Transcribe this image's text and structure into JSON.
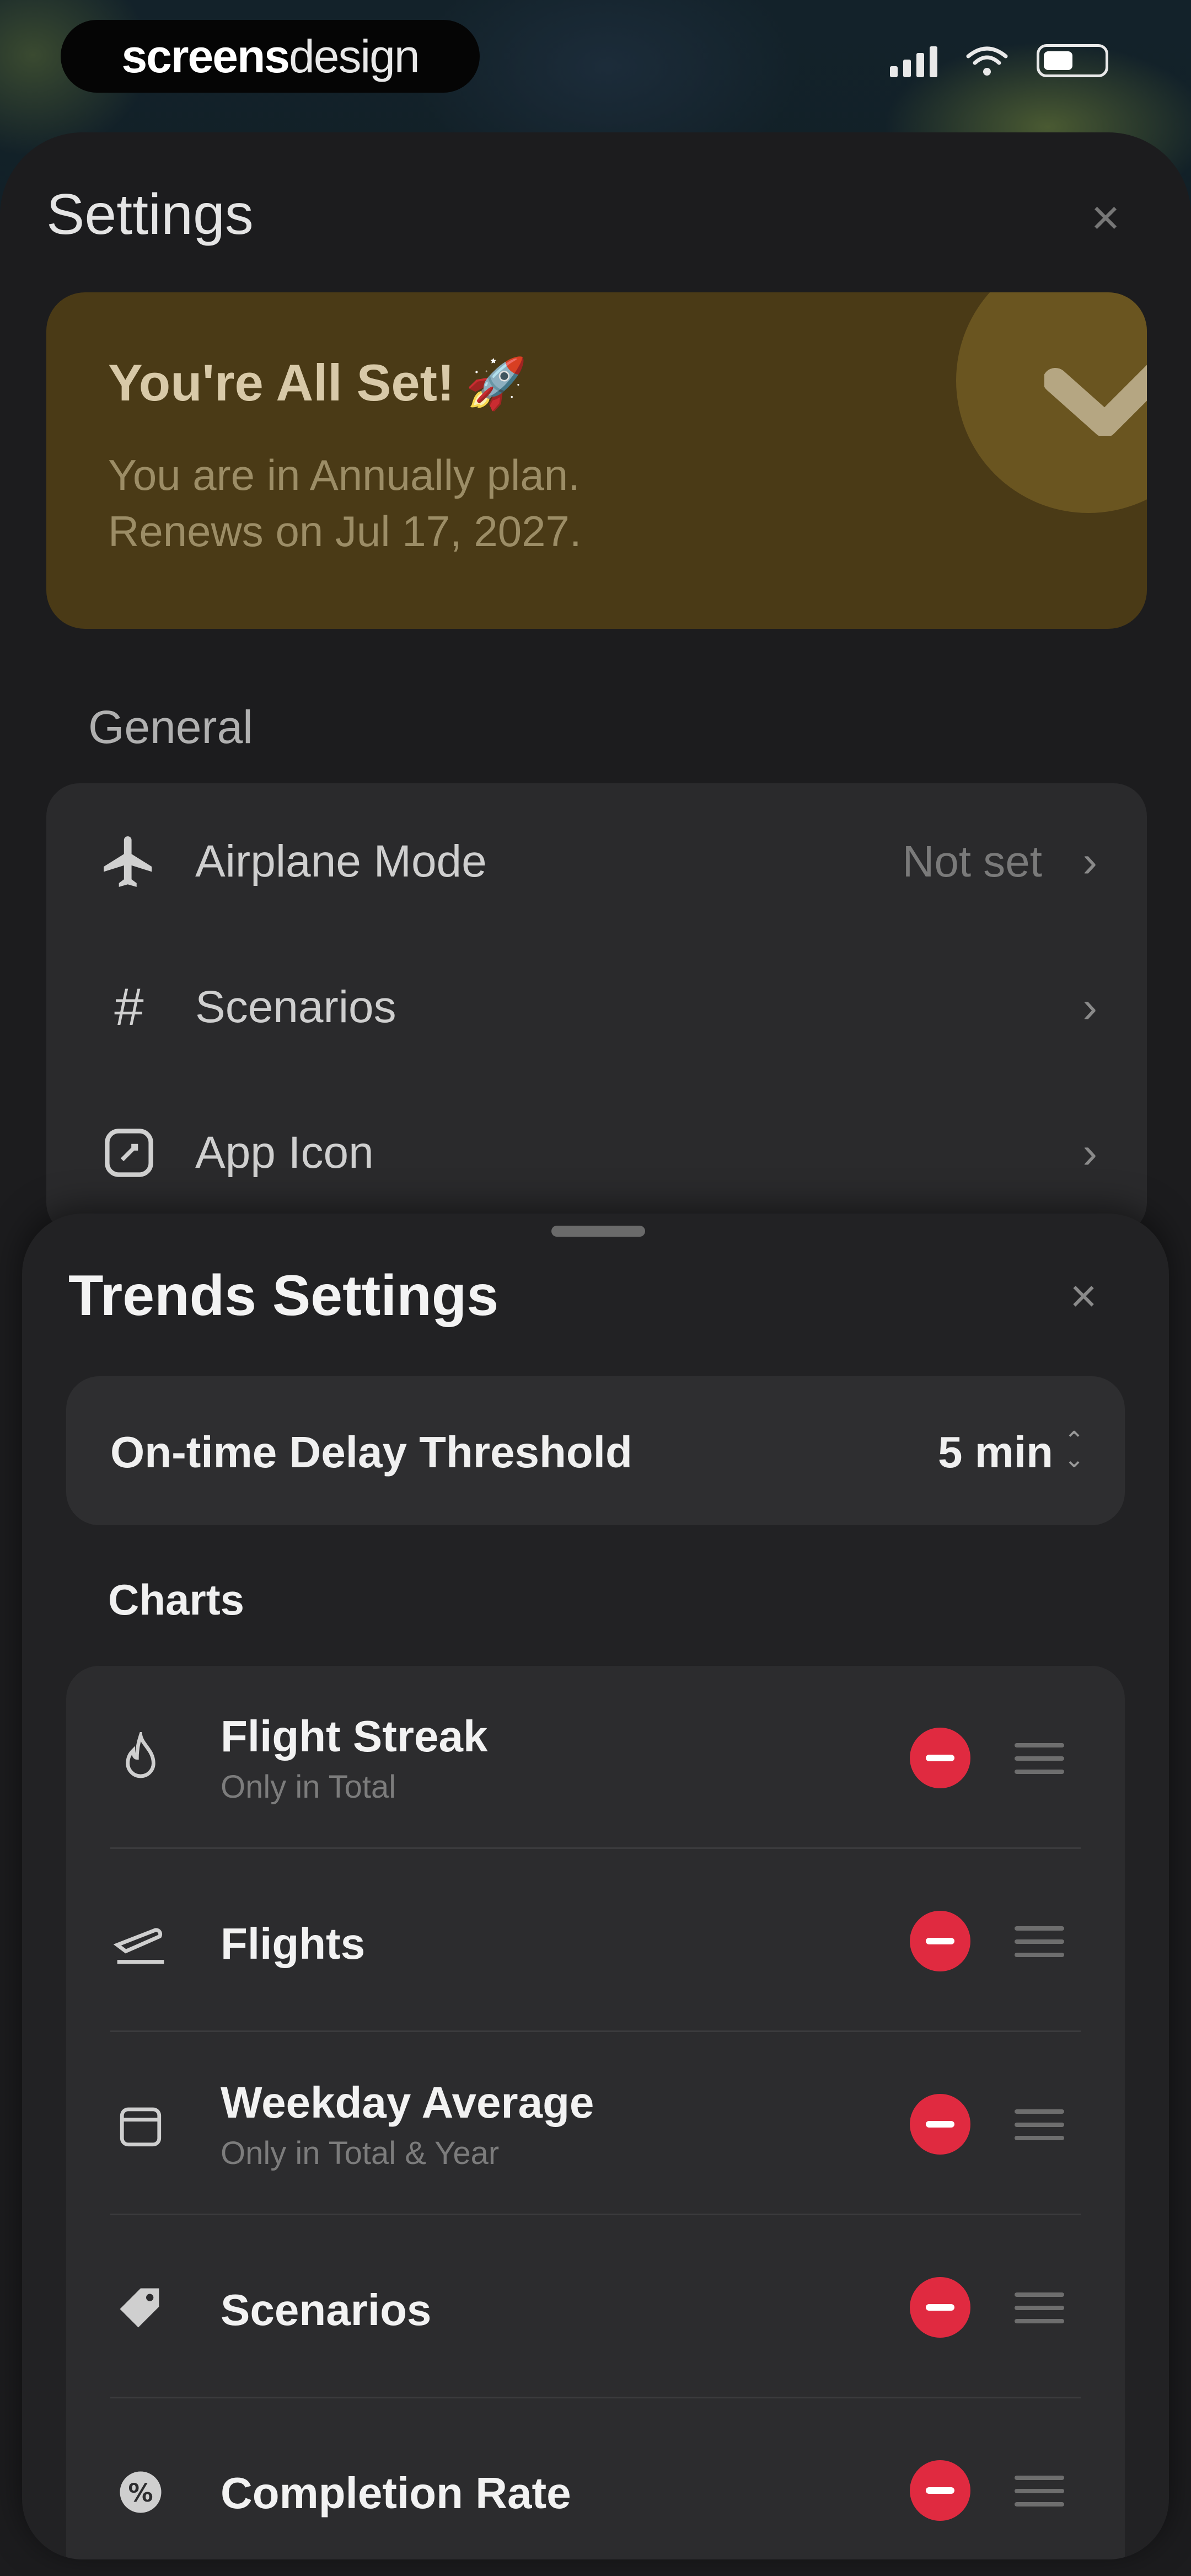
{
  "status_bar": {
    "brand": {
      "bold": "screens",
      "light": "design"
    }
  },
  "settings": {
    "title": "Settings",
    "close_icon": "close-icon",
    "plan_card": {
      "title": "You're All Set!",
      "emoji": "🚀",
      "line1": "You are in Annually plan.",
      "line2": "Renews on Jul 17, 2027.",
      "accent_color": "#4a3a16"
    },
    "general": {
      "label": "General",
      "items": [
        {
          "icon": "airplane-icon",
          "label": "Airplane Mode",
          "value": "Not set"
        },
        {
          "icon": "hashtag-icon",
          "label": "Scenarios",
          "value": ""
        },
        {
          "icon": "app-icon-icon",
          "label": "App Icon",
          "value": ""
        }
      ]
    }
  },
  "trends": {
    "title": "Trends Settings",
    "threshold": {
      "label": "On-time Delay Threshold",
      "value": "5 min"
    },
    "charts_label": "Charts",
    "charts": [
      {
        "icon": "flame-icon",
        "label": "Flight Streak",
        "sub": "Only in Total"
      },
      {
        "icon": "takeoff-icon",
        "label": "Flights",
        "sub": ""
      },
      {
        "icon": "calendar-icon",
        "label": "Weekday Average",
        "sub": "Only in Total & Year"
      },
      {
        "icon": "tag-icon",
        "label": "Scenarios",
        "sub": ""
      },
      {
        "icon": "percent-icon",
        "label": "Completion Rate",
        "sub": ""
      }
    ],
    "remove_color": "#e02a40"
  }
}
